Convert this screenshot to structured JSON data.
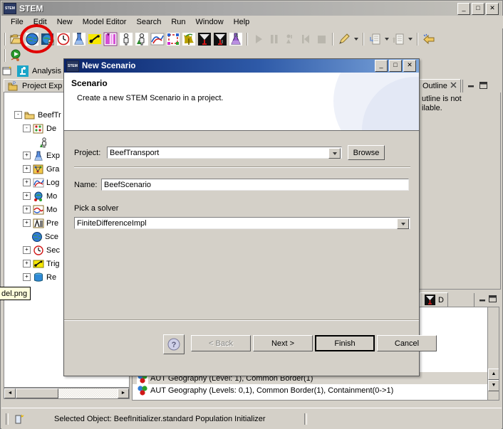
{
  "window": {
    "title": "STEM",
    "icon": "stem-icon",
    "buttons": {
      "minimize": "_",
      "maximize": "□",
      "close": "✕"
    }
  },
  "menu": {
    "items": [
      "File",
      "Edit",
      "New",
      "Model Editor",
      "Search",
      "Run",
      "Window",
      "Help"
    ]
  },
  "toolbar": {
    "row1": [
      {
        "name": "open-folder-icon"
      },
      {
        "name": "new-scenario-globe-icon",
        "highlighted": true
      },
      {
        "name": "new-graph-icon"
      },
      {
        "name": "new-sequencer-clock-icon"
      },
      {
        "name": "new-experiment-flask-icon"
      },
      {
        "name": "new-trigger-icon"
      },
      {
        "name": "new-predicate-icon"
      },
      {
        "name": "new-population-icon"
      },
      {
        "name": "new-population-model-icon"
      },
      {
        "name": "new-logger-icon"
      },
      {
        "name": "new-model-icon"
      },
      {
        "name": "new-infector-icon"
      },
      {
        "name": "new-decorator-icon"
      },
      {
        "name": "new-disease-icon"
      },
      {
        "name": "new-analysis-icon"
      }
    ],
    "row2": [
      {
        "name": "run-scenario-icon"
      },
      {
        "name": "debug-icon"
      }
    ],
    "run_controls": [
      {
        "name": "play-icon"
      },
      {
        "name": "pause-icon"
      },
      {
        "name": "step-icon"
      },
      {
        "name": "rewind-icon"
      },
      {
        "name": "stop-icon"
      }
    ],
    "extras": [
      {
        "name": "pencil-icon",
        "dropdown": true
      },
      {
        "name": "import-icon",
        "dropdown": true
      },
      {
        "name": "export-icon",
        "dropdown": true
      },
      {
        "name": "back-arrow-icon",
        "dropdown": false
      }
    ]
  },
  "perspective": {
    "label": "Analysis",
    "icon": "microscope-icon",
    "new_perspective_icon": "new-perspective-icon"
  },
  "project_explorer": {
    "tab_label": "Project Exp",
    "tab_icon": "project-explorer-icon",
    "tree": [
      {
        "label": "BeefTr",
        "indent": 0,
        "expander": "-",
        "icon": "folder-icon"
      },
      {
        "label": "De",
        "indent": 1,
        "expander": "-",
        "icon": "decorators-icon"
      },
      {
        "label": "",
        "indent": 2,
        "expander": "",
        "icon": "population-icon"
      },
      {
        "label": "Exp",
        "indent": 1,
        "expander": "+",
        "icon": "experiment-icon"
      },
      {
        "label": "Gra",
        "indent": 1,
        "expander": "+",
        "icon": "graph-icon"
      },
      {
        "label": "Log",
        "indent": 1,
        "expander": "+",
        "icon": "logger-icon"
      },
      {
        "label": "Mo",
        "indent": 1,
        "expander": "+",
        "icon": "model-icon"
      },
      {
        "label": "Mo",
        "indent": 1,
        "expander": "+",
        "icon": "modifier-icon"
      },
      {
        "label": "Pre",
        "indent": 1,
        "expander": "+",
        "icon": "predicate-icon"
      },
      {
        "label": "Sce",
        "indent": 1,
        "expander": "",
        "icon": "scenario-globe-icon"
      },
      {
        "label": "Sec",
        "indent": 1,
        "expander": "+",
        "icon": "sequencer-clock-icon"
      },
      {
        "label": "Trig",
        "indent": 1,
        "expander": "+",
        "icon": "trigger-icon"
      },
      {
        "label": "Re",
        "indent": 1,
        "expander": "+",
        "icon": "resource-icon"
      }
    ],
    "scroll": {
      "left_arrow": "◄",
      "right_arrow": "►"
    }
  },
  "tooltip": {
    "text": "del.png"
  },
  "outline": {
    "tab_label": "Outline",
    "close_icon": "close-icon",
    "minimize_icon": "minimize-icon",
    "maximize_icon": "maximize-icon",
    "message_line1": "utline is not",
    "message_line2": "ilable."
  },
  "bottom_view": {
    "tab_label": "D",
    "tab_icon": "decorator-icon",
    "minimize_icon": "minimize-icon",
    "maximize_icon": "maximize-icon",
    "rows": [
      {
        "label": "AUT Geography (Level: 1), Common Border(1)",
        "icon": "geography-icon",
        "selected": true
      },
      {
        "label": "AUT Geography (Levels: 0,1), Common Border(1), Containment(0->1)",
        "icon": "geography-icon",
        "selected": false
      }
    ],
    "scroll": {
      "up_arrow": "▲",
      "down_arrow": "▼"
    }
  },
  "status_bar": {
    "icon": "selection-icon",
    "text": "Selected Object: BeefInitializer.standard Population Initializer"
  },
  "dialog": {
    "title": "New Scenario",
    "icon": "stem-icon",
    "buttons": {
      "minimize": "_",
      "maximize": "□",
      "close": "✕"
    },
    "banner": {
      "heading": "Scenario",
      "description": "Create a new STEM Scenario in a project."
    },
    "project": {
      "label": "Project:",
      "value": "BeefTransport",
      "dropdown_icon": "chevron-down-icon",
      "browse_label": "Browse"
    },
    "name": {
      "label": "Name:",
      "value": "BeefScenario"
    },
    "solver": {
      "label": "Pick a solver",
      "value": "FiniteDifferenceImpl",
      "dropdown_icon": "chevron-down-icon"
    },
    "footer": {
      "help_icon": "help-icon",
      "back_label": "< Back",
      "next_label": "Next >",
      "finish_label": "Finish",
      "cancel_label": "Cancel"
    }
  },
  "colors": {
    "window_bg": "#d4d0c8",
    "dialog_title_start": "#0a246a",
    "dialog_title_end": "#7fa8dd",
    "annotation": "#e00000",
    "tooltip_bg": "#ffffdc"
  }
}
